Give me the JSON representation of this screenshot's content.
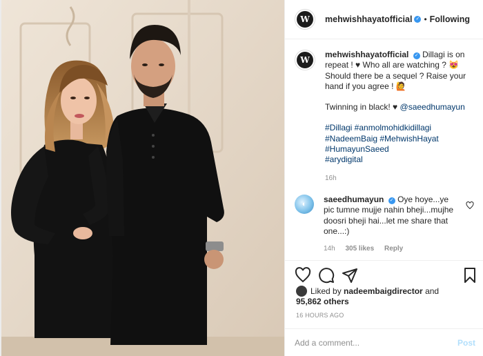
{
  "header": {
    "username": "mehwishhayatofficial",
    "dot": "•",
    "follow_label": "Following",
    "avatar_initial": "W"
  },
  "caption": {
    "username": "mehwishhayatofficial",
    "text1": "Dillagi is on repeat ! ♥ Who all are watching ? 😻 Should there be a sequel ? Raise your hand if you agree ! 🙋",
    "text2_prefix": "Twinning in black! ♥ ",
    "mention": "@saeedhumayun",
    "hashtags": [
      "#Dillagi #anmolmohidkidillagi",
      "#NadeemBaig #MehwishHayat",
      "#HumayunSaeed",
      "#arydigital"
    ],
    "time": "16h"
  },
  "comment": {
    "username": "saeedhumayun",
    "text": "Oye hoye...ye pic tumne mujje nahin bheji...mujhe doosri bheji hai...let me share that one...:)",
    "time": "14h",
    "likes": "305 likes",
    "reply": "Reply"
  },
  "likes": {
    "prefix": "Liked by ",
    "user": "nadeembaigdirector",
    "conj": " and",
    "count": "95,862 others"
  },
  "timestamp": "16 HOURS AGO",
  "add_comment": {
    "placeholder": "Add a comment...",
    "post_label": "Post"
  },
  "icons": [
    "heart-icon",
    "comment-icon",
    "share-icon",
    "bookmark-icon",
    "verified-icon"
  ],
  "colors": {
    "link": "#00376b",
    "verified": "#3897f0",
    "muted": "#8e8e8e",
    "post_disabled": "#b2dffc"
  }
}
